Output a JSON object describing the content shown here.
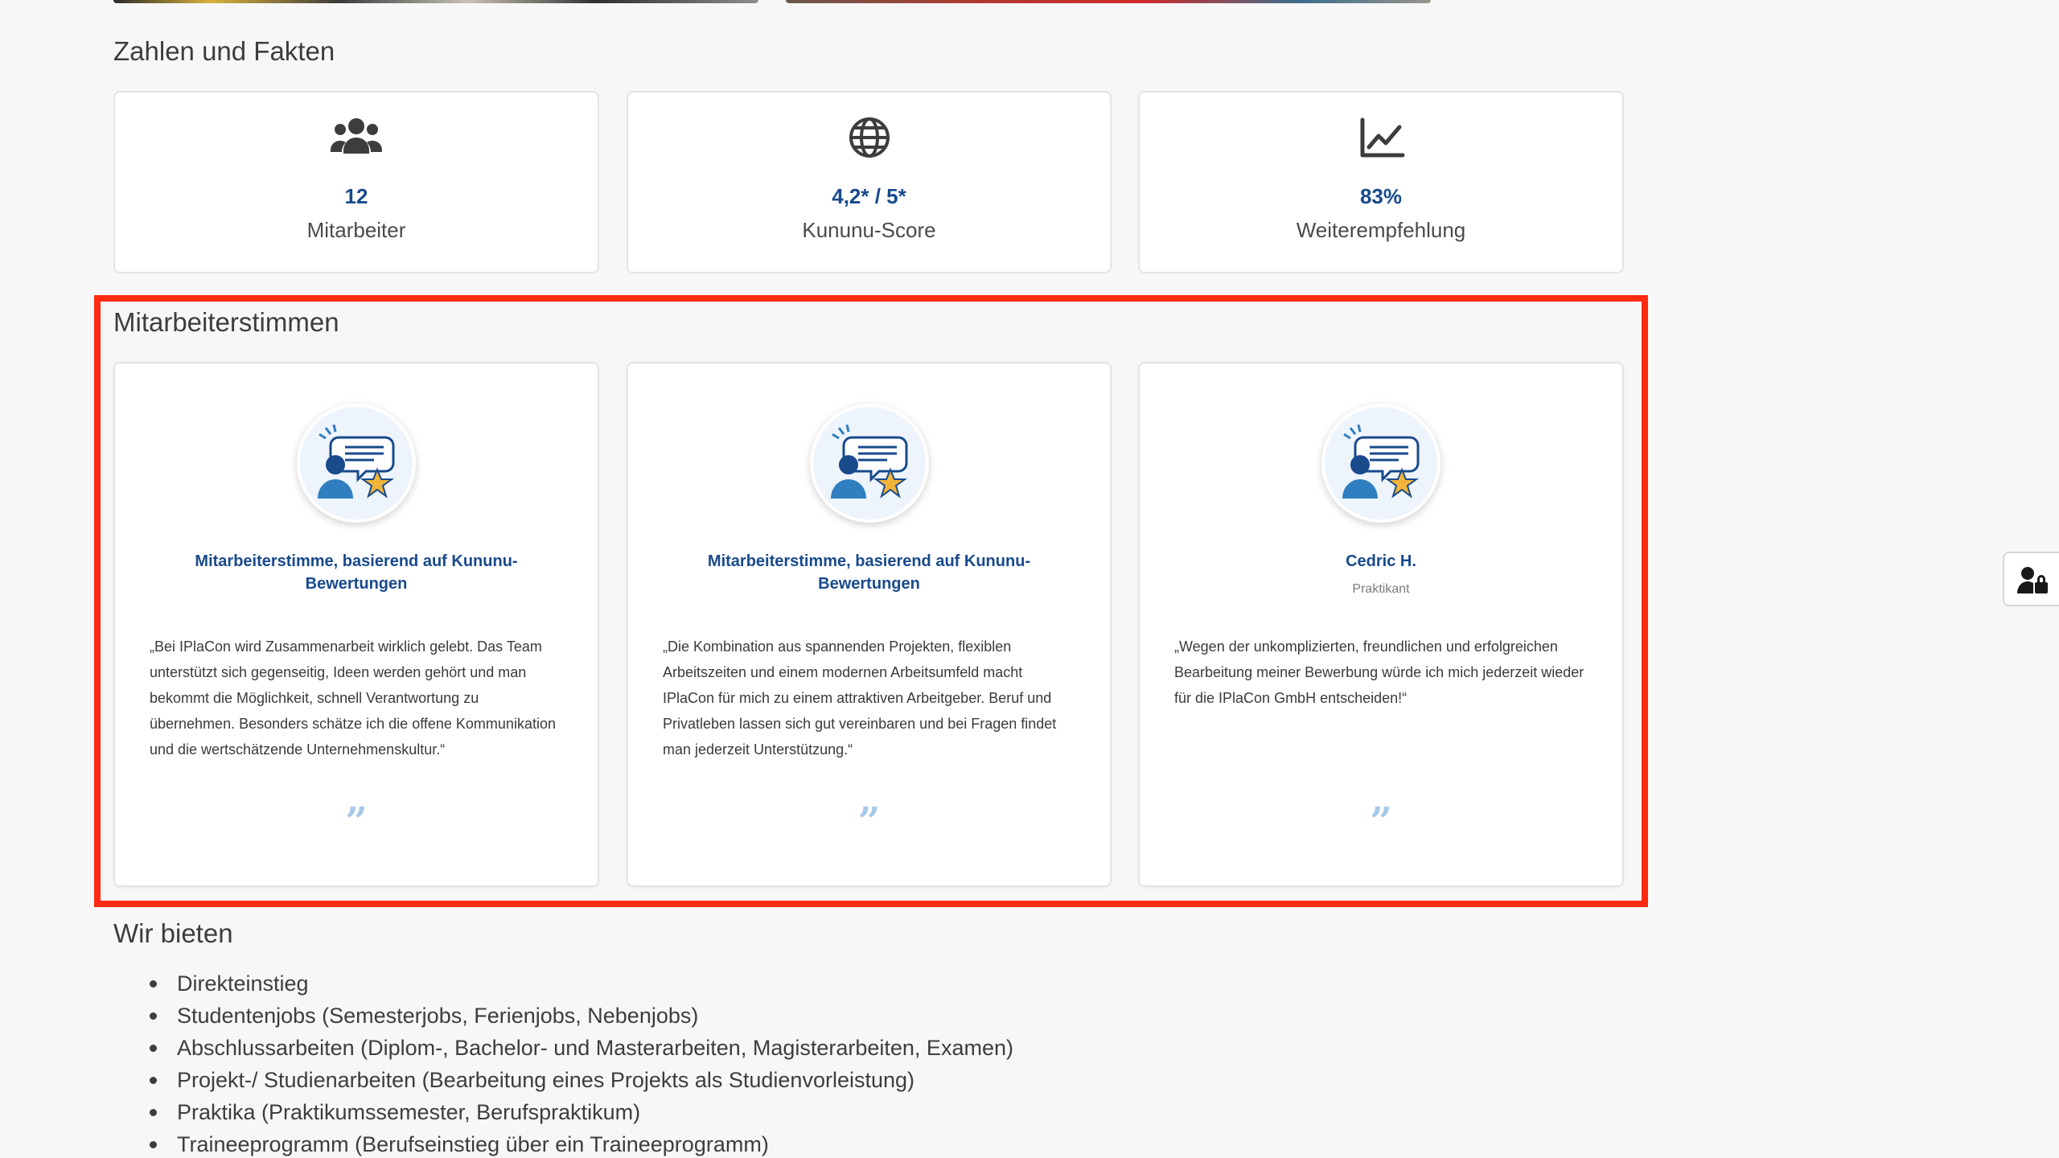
{
  "facts": {
    "title": "Zahlen und Fakten",
    "items": [
      {
        "value": "12",
        "label": "Mitarbeiter",
        "icon": "users-icon"
      },
      {
        "value": "4,2* / 5*",
        "label": "Kununu-Score",
        "icon": "globe-icon"
      },
      {
        "value": "83%",
        "label": "Weiterempfehlung",
        "icon": "line-chart-icon"
      }
    ]
  },
  "testimonials": {
    "title": "Mitarbeiterstimmen",
    "items": [
      {
        "name": "Mitarbeiterstimme, basierend auf Kununu-Bewertungen",
        "role": "",
        "text": "„Bei IPlaCon wird Zusammenarbeit wirklich gelebt. Das Team unterstützt sich gegenseitig, Ideen werden gehört und man bekommt die Möglichkeit, schnell Verantwortung zu übernehmen. Besonders schätze ich die offene Kommunikation und die wertschätzende Unternehmenskultur.“",
        "quote_mark": "”"
      },
      {
        "name": "Mitarbeiterstimme, basierend auf Kununu-Bewertungen",
        "role": "",
        "text": "„Die Kombination aus spannenden Projekten, flexiblen Arbeitszeiten und einem modernen Arbeitsumfeld macht IPlaCon für mich zu einem attraktiven Arbeitgeber. Beruf und Privatleben lassen sich gut vereinbaren und bei Fragen findet man jederzeit Unterstützung.“",
        "quote_mark": "”"
      },
      {
        "name": "Cedric H.",
        "role": "Praktikant",
        "text": "„Wegen der unkomplizierten, freundlichen und erfolgreichen Bearbeitung meiner Bewerbung würde ich mich jederzeit wieder für die IPlaCon GmbH entscheiden!“",
        "quote_mark": "”"
      }
    ]
  },
  "offers": {
    "title": "Wir bieten",
    "items": [
      "Direkteinstieg",
      "Studentenjobs (Semesterjobs, Ferienjobs, Nebenjobs)",
      "Abschlussarbeiten (Diplom-, Bachelor- und Masterarbeiten, Magisterarbeiten, Examen)",
      "Projekt-/ Studienarbeiten (Bearbeitung eines Projekts als Studienvorleistung)",
      "Praktika (Praktikumssemester, Berufspraktikum)",
      "Traineeprogramm (Berufseinstieg über ein Traineeprogramm)"
    ]
  },
  "colors": {
    "accent": "#184a8c",
    "highlight": "#ff2a12",
    "quote": "#a8c8ea"
  },
  "side_button": {
    "icon": "user-lock-icon"
  }
}
